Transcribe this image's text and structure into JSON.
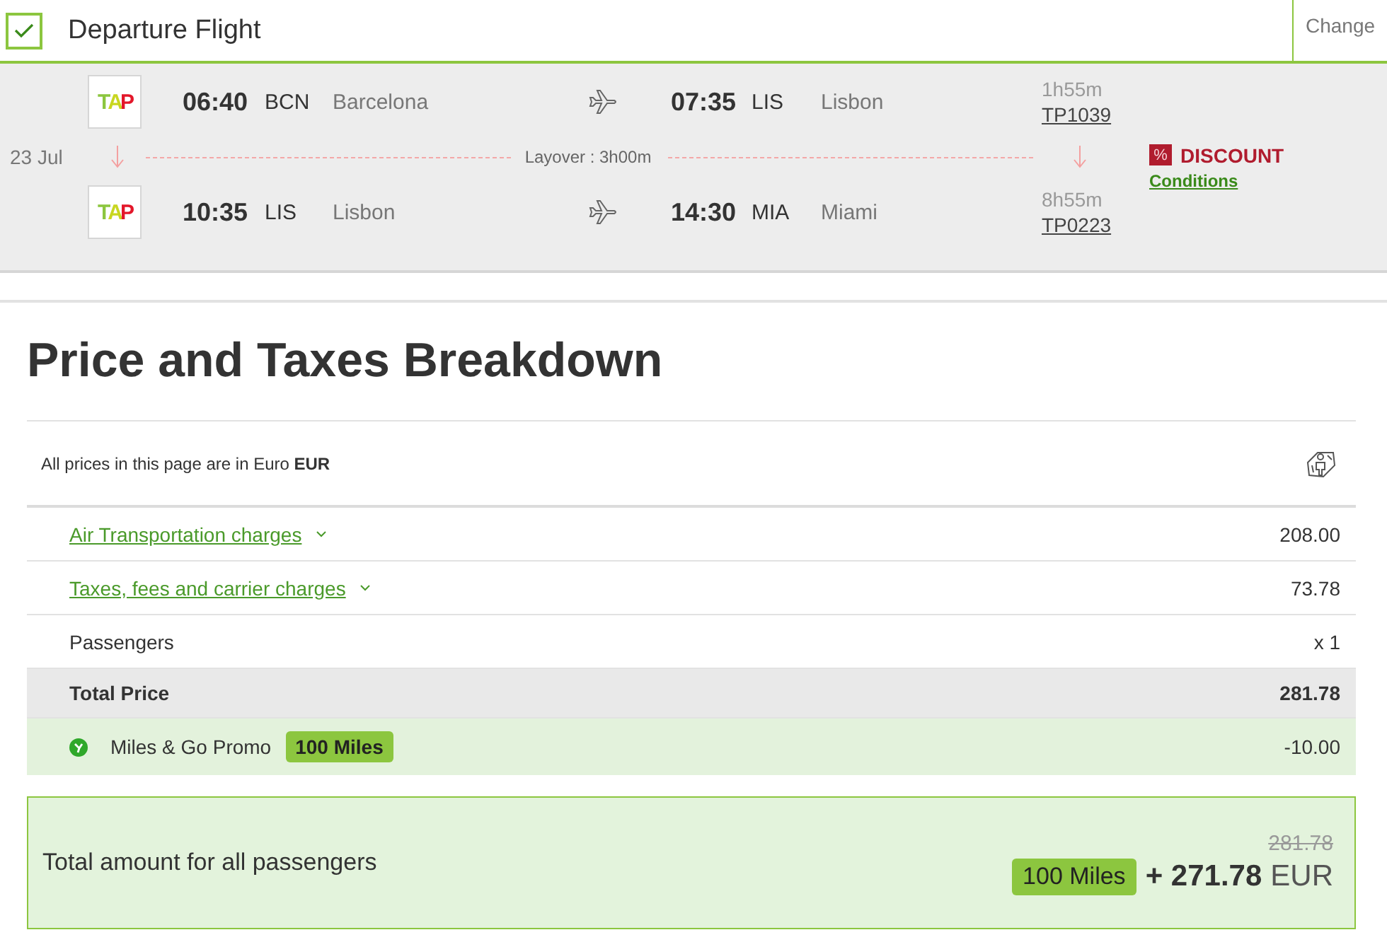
{
  "header": {
    "checked": true,
    "title": "Departure Flight",
    "change_button": "Change"
  },
  "segments": [
    {
      "logo": "TAP",
      "dep_time": "06:40",
      "dep_code": "BCN",
      "dep_city": "Barcelona",
      "arr_time": "07:35",
      "arr_code": "LIS",
      "arr_city": "Lisbon",
      "duration": "1h55m",
      "flight_number": "TP1039"
    },
    {
      "logo": "TAP",
      "dep_time": "10:35",
      "dep_code": "LIS",
      "dep_city": "Lisbon",
      "arr_time": "14:30",
      "arr_code": "MIA",
      "arr_city": "Miami",
      "duration": "8h55m",
      "flight_number": "TP0223"
    }
  ],
  "layover": {
    "date": "23 Jul",
    "label": "Layover : 3h00m"
  },
  "discount": {
    "icon": "%",
    "label": "DISCOUNT",
    "link": "Conditions"
  },
  "breakdown": {
    "title": "Price and Taxes Breakdown",
    "currency_note": "All prices in this page are in Euro **EUR**",
    "rows": [
      {
        "kind": "expandable",
        "label": "Air Transportation charges",
        "value": "208.00"
      },
      {
        "kind": "expandable",
        "label": "Taxes, fees and carrier charges",
        "value": "73.78"
      },
      {
        "kind": "plain",
        "label": "Passengers",
        "value": "x 1"
      },
      {
        "kind": "total",
        "label": "Total Price",
        "value": "281.78"
      },
      {
        "kind": "promo",
        "label": "Miles & Go Promo",
        "badge": "100 Miles",
        "value": "-10.00"
      }
    ]
  },
  "total": {
    "label": "Total amount for all passengers",
    "old_price": "281.78",
    "miles": "100 Miles",
    "amount": "+ 271.78",
    "currency": "EUR"
  }
}
